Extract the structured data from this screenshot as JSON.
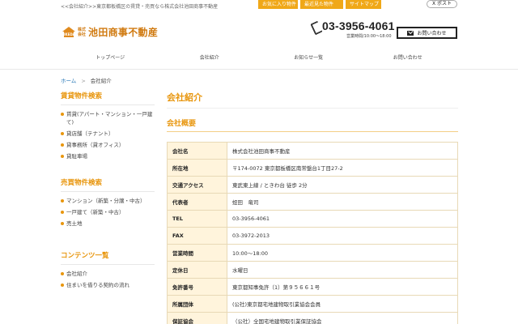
{
  "topbar": {
    "tagline": "<<会社紹介>>東京都板橋区の賃貸・売買なら株式会社池田商事不動産",
    "buttons": [
      "お気に入り物件",
      "最近見た物件",
      "サイトマップ"
    ],
    "xpost": "X ポスト"
  },
  "header": {
    "logo_mark": "IKEDA",
    "logo_small": [
      "株式",
      "会社"
    ],
    "logo_name": "池田商事不動産",
    "phone": "03-3956-4061",
    "hours": "営業時間/10:00〜18:00",
    "contact_label": "お問い合わせ"
  },
  "nav": [
    "トップページ",
    "会社紹介",
    "お知らせ一覧",
    "お問い合わせ"
  ],
  "breadcrumb": {
    "home": "ホーム",
    "sep": ">",
    "current": "会社紹介"
  },
  "sidebar": [
    {
      "title": "賃貸物件検索",
      "items": [
        "賃貸(アパート・マンション・一戸建て)",
        "貸店舗（テナント）",
        "貸事務所（貸オフィス）",
        "貸駐車場"
      ]
    },
    {
      "title": "売買物件検索",
      "items": [
        "マンション（新築・分譲・中古）",
        "一戸建て（新築・中古）",
        "売土地"
      ]
    },
    {
      "title": "コンテンツ一覧",
      "items": [
        "会社紹介",
        "住まいを借りる契約の流れ"
      ]
    }
  ],
  "main": {
    "title": "会社紹介",
    "subtitle": "会社概要",
    "rows": [
      {
        "label": "会社名",
        "value": "株式会社池田商事不動産"
      },
      {
        "label": "所在地",
        "value": "〒174-0072 東京都板橋区南常盤台1丁目27-2"
      },
      {
        "label": "交通アクセス",
        "value": "東武東上線 / ときわ台 徒歩 2分"
      },
      {
        "label": "代表者",
        "value": "蛭田　竜司"
      },
      {
        "label": "TEL",
        "value": "03-3956-4061"
      },
      {
        "label": "FAX",
        "value": "03-3972-2013"
      },
      {
        "label": "営業時間",
        "value": "10:00〜18:00"
      },
      {
        "label": "定休日",
        "value": "水曜日"
      },
      {
        "label": "免許番号",
        "value": "東京都知事免許（1）第９５６６１号"
      },
      {
        "label": "所属団体",
        "value": "(公社)東京都宅地建物取引業協会会員"
      },
      {
        "label": "保証協会",
        "value": "（公社）全国宅地建物取引業保証協会"
      }
    ]
  },
  "colors": {
    "accent": "#e8960e",
    "table_header_bg": "#fff4dc"
  }
}
